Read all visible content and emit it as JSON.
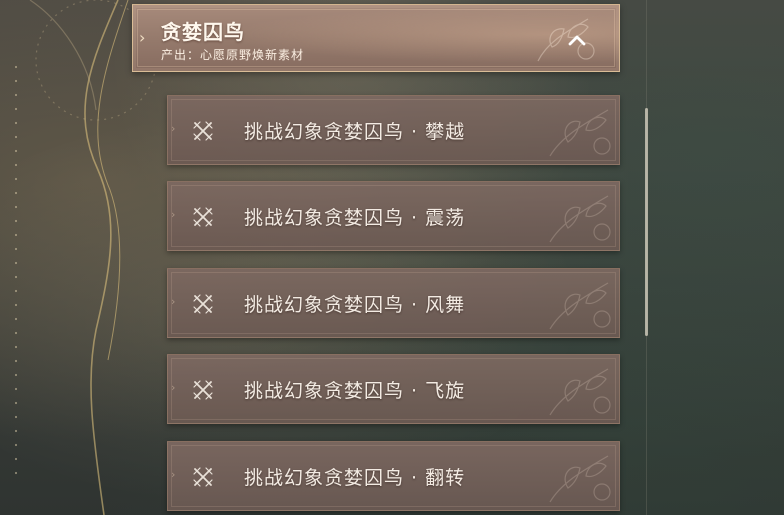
{
  "category": {
    "title": "贪婪囚鸟",
    "subtitle": "产出：心愿原野焕新素材",
    "expanded": true,
    "collapse_icon": "chevron-up-icon"
  },
  "challenges": [
    {
      "label": "挑战幻象贪婪囚鸟 · 攀越",
      "icon": "crossed-swords-icon"
    },
    {
      "label": "挑战幻象贪婪囚鸟 · 震荡",
      "icon": "crossed-swords-icon"
    },
    {
      "label": "挑战幻象贪婪囚鸟 · 风舞",
      "icon": "crossed-swords-icon"
    },
    {
      "label": "挑战幻象贪婪囚鸟 · 飞旋",
      "icon": "crossed-swords-icon"
    },
    {
      "label": "挑战幻象贪婪囚鸟 · 翻转",
      "icon": "crossed-swords-icon"
    }
  ],
  "colors": {
    "header_bg": "#94796b",
    "item_bg": "#746059",
    "text": "#f3ebe3",
    "accent_border": "#ebcda0"
  }
}
